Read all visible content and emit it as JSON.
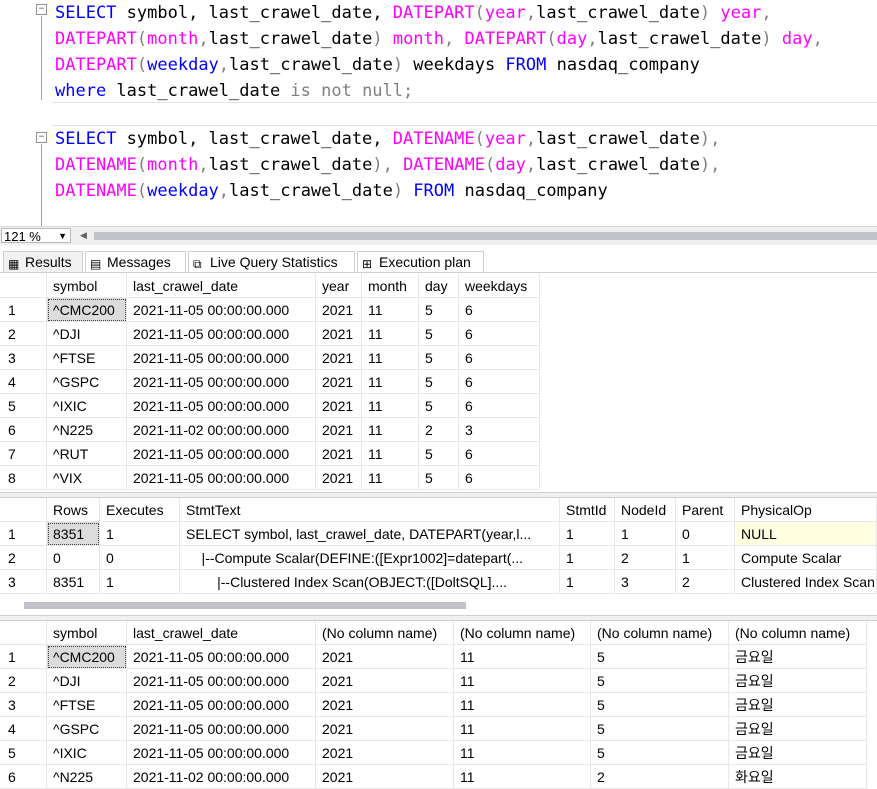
{
  "editor": {
    "lines": [
      {
        "parts": [
          [
            "kw",
            "SELECT "
          ],
          [
            "tx",
            "symbol, last_crawel_date, "
          ],
          [
            "fn",
            "DATEPART"
          ],
          [
            "op",
            "("
          ],
          [
            "fn",
            "year"
          ],
          [
            "op",
            ","
          ],
          [
            "tx",
            "last_crawel_date"
          ],
          [
            "op",
            ") "
          ],
          [
            "fn",
            "year"
          ],
          [
            "op",
            ","
          ]
        ]
      },
      {
        "parts": [
          [
            "fn",
            "DATEPART"
          ],
          [
            "op",
            "("
          ],
          [
            "fn",
            "month"
          ],
          [
            "op",
            ","
          ],
          [
            "tx",
            "last_crawel_date"
          ],
          [
            "op",
            ") "
          ],
          [
            "fn",
            "month"
          ],
          [
            "op",
            ", "
          ],
          [
            "fn",
            "DATEPART"
          ],
          [
            "op",
            "("
          ],
          [
            "fn",
            "day"
          ],
          [
            "op",
            ","
          ],
          [
            "tx",
            "last_crawel_date"
          ],
          [
            "op",
            ") "
          ],
          [
            "fn",
            "day"
          ],
          [
            "op",
            ","
          ]
        ]
      },
      {
        "parts": [
          [
            "fn",
            "DATEPART"
          ],
          [
            "op",
            "("
          ],
          [
            "kw",
            "weekday"
          ],
          [
            "op",
            ","
          ],
          [
            "tx",
            "last_crawel_date"
          ],
          [
            "op",
            ") "
          ],
          [
            "tx",
            "weekdays "
          ],
          [
            "kw",
            "FROM "
          ],
          [
            "tx",
            "nasdaq_company"
          ]
        ]
      },
      {
        "parts": [
          [
            "kw",
            "where "
          ],
          [
            "tx",
            "last_crawel_date "
          ],
          [
            "op",
            "is not null;"
          ]
        ]
      },
      {
        "parts": []
      },
      {
        "parts": [
          [
            "kw",
            "SELECT "
          ],
          [
            "tx",
            "symbol, last_crawel_date, "
          ],
          [
            "fn",
            "DATENAME"
          ],
          [
            "op",
            "("
          ],
          [
            "fn",
            "year"
          ],
          [
            "op",
            ","
          ],
          [
            "tx",
            "last_crawel_date"
          ],
          [
            "op",
            "),"
          ]
        ]
      },
      {
        "parts": [
          [
            "fn",
            "DATENAME"
          ],
          [
            "op",
            "("
          ],
          [
            "fn",
            "month"
          ],
          [
            "op",
            ","
          ],
          [
            "tx",
            "last_crawel_date"
          ],
          [
            "op",
            "), "
          ],
          [
            "fn",
            "DATENAME"
          ],
          [
            "op",
            "("
          ],
          [
            "fn",
            "day"
          ],
          [
            "op",
            ","
          ],
          [
            "tx",
            "last_crawel_date"
          ],
          [
            "op",
            "),"
          ]
        ]
      },
      {
        "parts": [
          [
            "fn",
            "DATENAME"
          ],
          [
            "op",
            "("
          ],
          [
            "kw",
            "weekday"
          ],
          [
            "op",
            ","
          ],
          [
            "tx",
            "last_crawel_date"
          ],
          [
            "op",
            ") "
          ],
          [
            "kw",
            "FROM "
          ],
          [
            "tx",
            "nasdaq_company"
          ]
        ]
      }
    ]
  },
  "zoom": {
    "value": "121 %"
  },
  "tabs": [
    {
      "label": "Results",
      "icon": "grid-icon"
    },
    {
      "label": "Messages",
      "icon": "message-icon"
    },
    {
      "label": "Live Query Statistics",
      "icon": "stats-icon"
    },
    {
      "label": "Execution plan",
      "icon": "plan-icon"
    }
  ],
  "grid1": {
    "columns": [
      "symbol",
      "last_crawel_date",
      "year",
      "month",
      "day",
      "weekdays"
    ],
    "rows": [
      [
        "1",
        "^CMC200",
        "2021-11-05 00:00:00.000",
        "2021",
        "11",
        "5",
        "6"
      ],
      [
        "2",
        "^DJI",
        "2021-11-05 00:00:00.000",
        "2021",
        "11",
        "5",
        "6"
      ],
      [
        "3",
        "^FTSE",
        "2021-11-05 00:00:00.000",
        "2021",
        "11",
        "5",
        "6"
      ],
      [
        "4",
        "^GSPC",
        "2021-11-05 00:00:00.000",
        "2021",
        "11",
        "5",
        "6"
      ],
      [
        "5",
        "^IXIC",
        "2021-11-05 00:00:00.000",
        "2021",
        "11",
        "5",
        "6"
      ],
      [
        "6",
        "^N225",
        "2021-11-02 00:00:00.000",
        "2021",
        "11",
        "2",
        "3"
      ],
      [
        "7",
        "^RUT",
        "2021-11-05 00:00:00.000",
        "2021",
        "11",
        "5",
        "6"
      ],
      [
        "8",
        "^VIX",
        "2021-11-05 00:00:00.000",
        "2021",
        "11",
        "5",
        "6"
      ]
    ]
  },
  "grid2": {
    "columns": [
      "Rows",
      "Executes",
      "StmtText",
      "StmtId",
      "NodeId",
      "Parent",
      "PhysicalOp"
    ],
    "rows": [
      [
        "1",
        "8351",
        "1",
        "SELECT symbol, last_crawel_date, DATEPART(year,l...",
        "1",
        "1",
        "0",
        "NULL"
      ],
      [
        "2",
        "0",
        "0",
        "    |--Compute Scalar(DEFINE:([Expr1002]=datepart(...",
        "1",
        "2",
        "1",
        "Compute Scalar"
      ],
      [
        "3",
        "8351",
        "1",
        "        |--Clustered Index Scan(OBJECT:([DoltSQL]....",
        "1",
        "3",
        "2",
        "Clustered Index Scan"
      ]
    ]
  },
  "grid3": {
    "columns": [
      "symbol",
      "last_crawel_date",
      "(No column name)",
      "(No column name)",
      "(No column name)",
      "(No column name)"
    ],
    "rows": [
      [
        "1",
        "^CMC200",
        "2021-11-05 00:00:00.000",
        "2021",
        "11",
        "5",
        "금요일"
      ],
      [
        "2",
        "^DJI",
        "2021-11-05 00:00:00.000",
        "2021",
        "11",
        "5",
        "금요일"
      ],
      [
        "3",
        "^FTSE",
        "2021-11-05 00:00:00.000",
        "2021",
        "11",
        "5",
        "금요일"
      ],
      [
        "4",
        "^GSPC",
        "2021-11-05 00:00:00.000",
        "2021",
        "11",
        "5",
        "금요일"
      ],
      [
        "5",
        "^IXIC",
        "2021-11-05 00:00:00.000",
        "2021",
        "11",
        "5",
        "금요일"
      ],
      [
        "6",
        "^N225",
        "2021-11-02 00:00:00.000",
        "2021",
        "11",
        "2",
        "화요일"
      ]
    ]
  }
}
